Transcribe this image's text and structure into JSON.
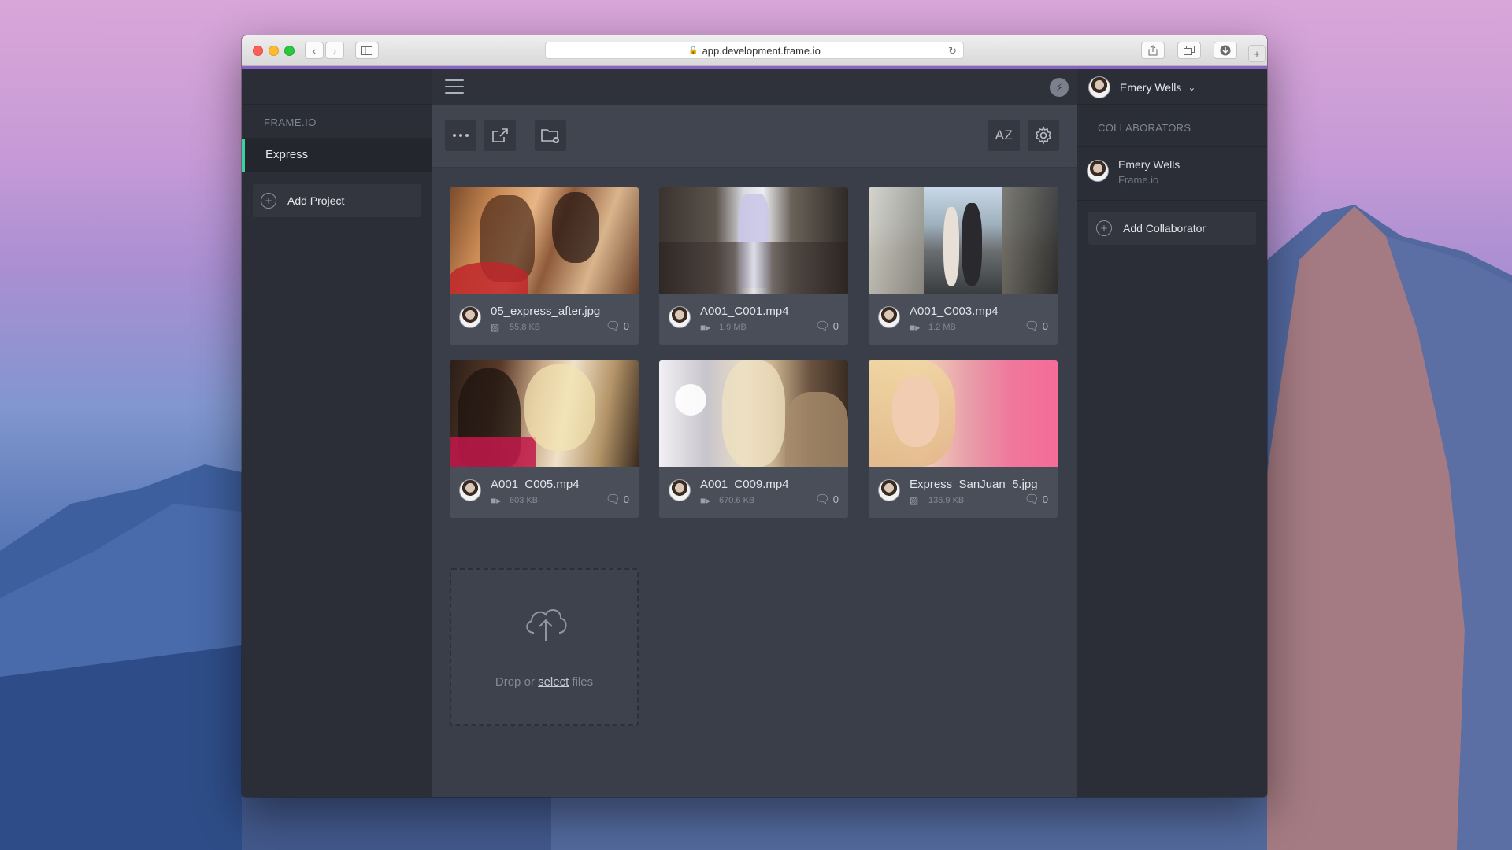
{
  "browser": {
    "url": "app.development.frame.io"
  },
  "sidebar": {
    "brand": "FRAME.IO",
    "projects": [
      {
        "label": "Express"
      }
    ],
    "add_project_label": "Add Project"
  },
  "toolbar": {
    "sort_label": "AZ"
  },
  "assets": [
    {
      "name": "05_express_after.jpg",
      "type": "image",
      "size": "55.8 KB",
      "comments": "0"
    },
    {
      "name": "A001_C001.mp4",
      "type": "video",
      "size": "1.9 MB",
      "comments": "0"
    },
    {
      "name": "A001_C003.mp4",
      "type": "video",
      "size": "1.2 MB",
      "comments": "0"
    },
    {
      "name": "A001_C005.mp4",
      "type": "video",
      "size": "603 KB",
      "comments": "0"
    },
    {
      "name": "A001_C009.mp4",
      "type": "video",
      "size": "670.6 KB",
      "comments": "0"
    },
    {
      "name": "Express_SanJuan_5.jpg",
      "type": "image",
      "size": "136.9 KB",
      "comments": "0"
    }
  ],
  "upload": {
    "prefix": "Drop or ",
    "link": "select",
    "suffix": " files"
  },
  "user": {
    "name": "Emery Wells"
  },
  "collaborators_panel": {
    "heading": "COLLABORATORS",
    "collaborators": [
      {
        "name": "Emery Wells",
        "org": "Frame.io"
      }
    ],
    "add_label": "Add Collaborator"
  },
  "colors": {
    "accent": "#3fd19b",
    "bar": "#8a63c8"
  }
}
